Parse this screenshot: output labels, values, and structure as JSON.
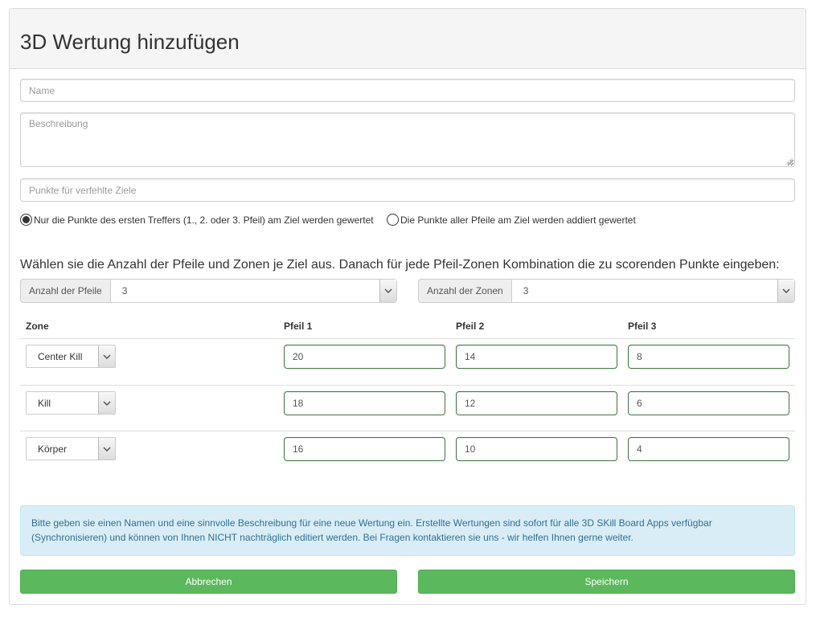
{
  "title": "3D Wertung hinzufügen",
  "form": {
    "name_placeholder": "Name",
    "description_placeholder": "Beschreibung",
    "missed_points_placeholder": "Punkte für verfehlte Ziele"
  },
  "scoring_mode": {
    "options": [
      {
        "label": "Nur die Punkte des ersten Treffers (1., 2. oder 3. Pfeil) am Ziel werden gewertet",
        "selected": true
      },
      {
        "label": "Die Punkte aller Pfeile am Ziel werden addiert gewertet",
        "selected": false
      }
    ]
  },
  "instruction": "Wählen sie die Anzahl der Pfeile und Zonen je Ziel aus. Danach für jede Pfeil-Zonen Kombination die zu scorenden Punkte eingeben:",
  "arrows_select": {
    "label": "Anzahl der Pfeile",
    "value": "3"
  },
  "zones_select": {
    "label": "Anzahl der Zonen",
    "value": "3"
  },
  "table": {
    "headers": [
      "Zone",
      "Pfeil 1",
      "Pfeil 2",
      "Pfeil 3"
    ],
    "rows": [
      {
        "zone": "Center Kill",
        "scores": [
          "20",
          "14",
          "8"
        ]
      },
      {
        "zone": "Kill",
        "scores": [
          "18",
          "12",
          "6"
        ]
      },
      {
        "zone": "Körper",
        "scores": [
          "16",
          "10",
          "4"
        ]
      }
    ]
  },
  "info_text": "Bitte geben sie einen Namen und eine sinnvolle Beschreibung für eine neue Wertung ein. Erstellte Wertungen sind sofort für alle 3D SKill Board Apps verfügbar (Synchronisieren) und können von Ihnen NICHT nachträglich editiert werden. Bei Fragen kontaktieren sie uns - wir helfen Ihnen gerne weiter.",
  "buttons": {
    "cancel": "Abbrechen",
    "save": "Speichern"
  },
  "colors": {
    "primary_green": "#5cb85c",
    "success_border": "#3c763d",
    "info_bg": "#d9edf7",
    "info_text": "#31708f"
  },
  "icons": {
    "select_arrow": "chevron-down-icon"
  }
}
